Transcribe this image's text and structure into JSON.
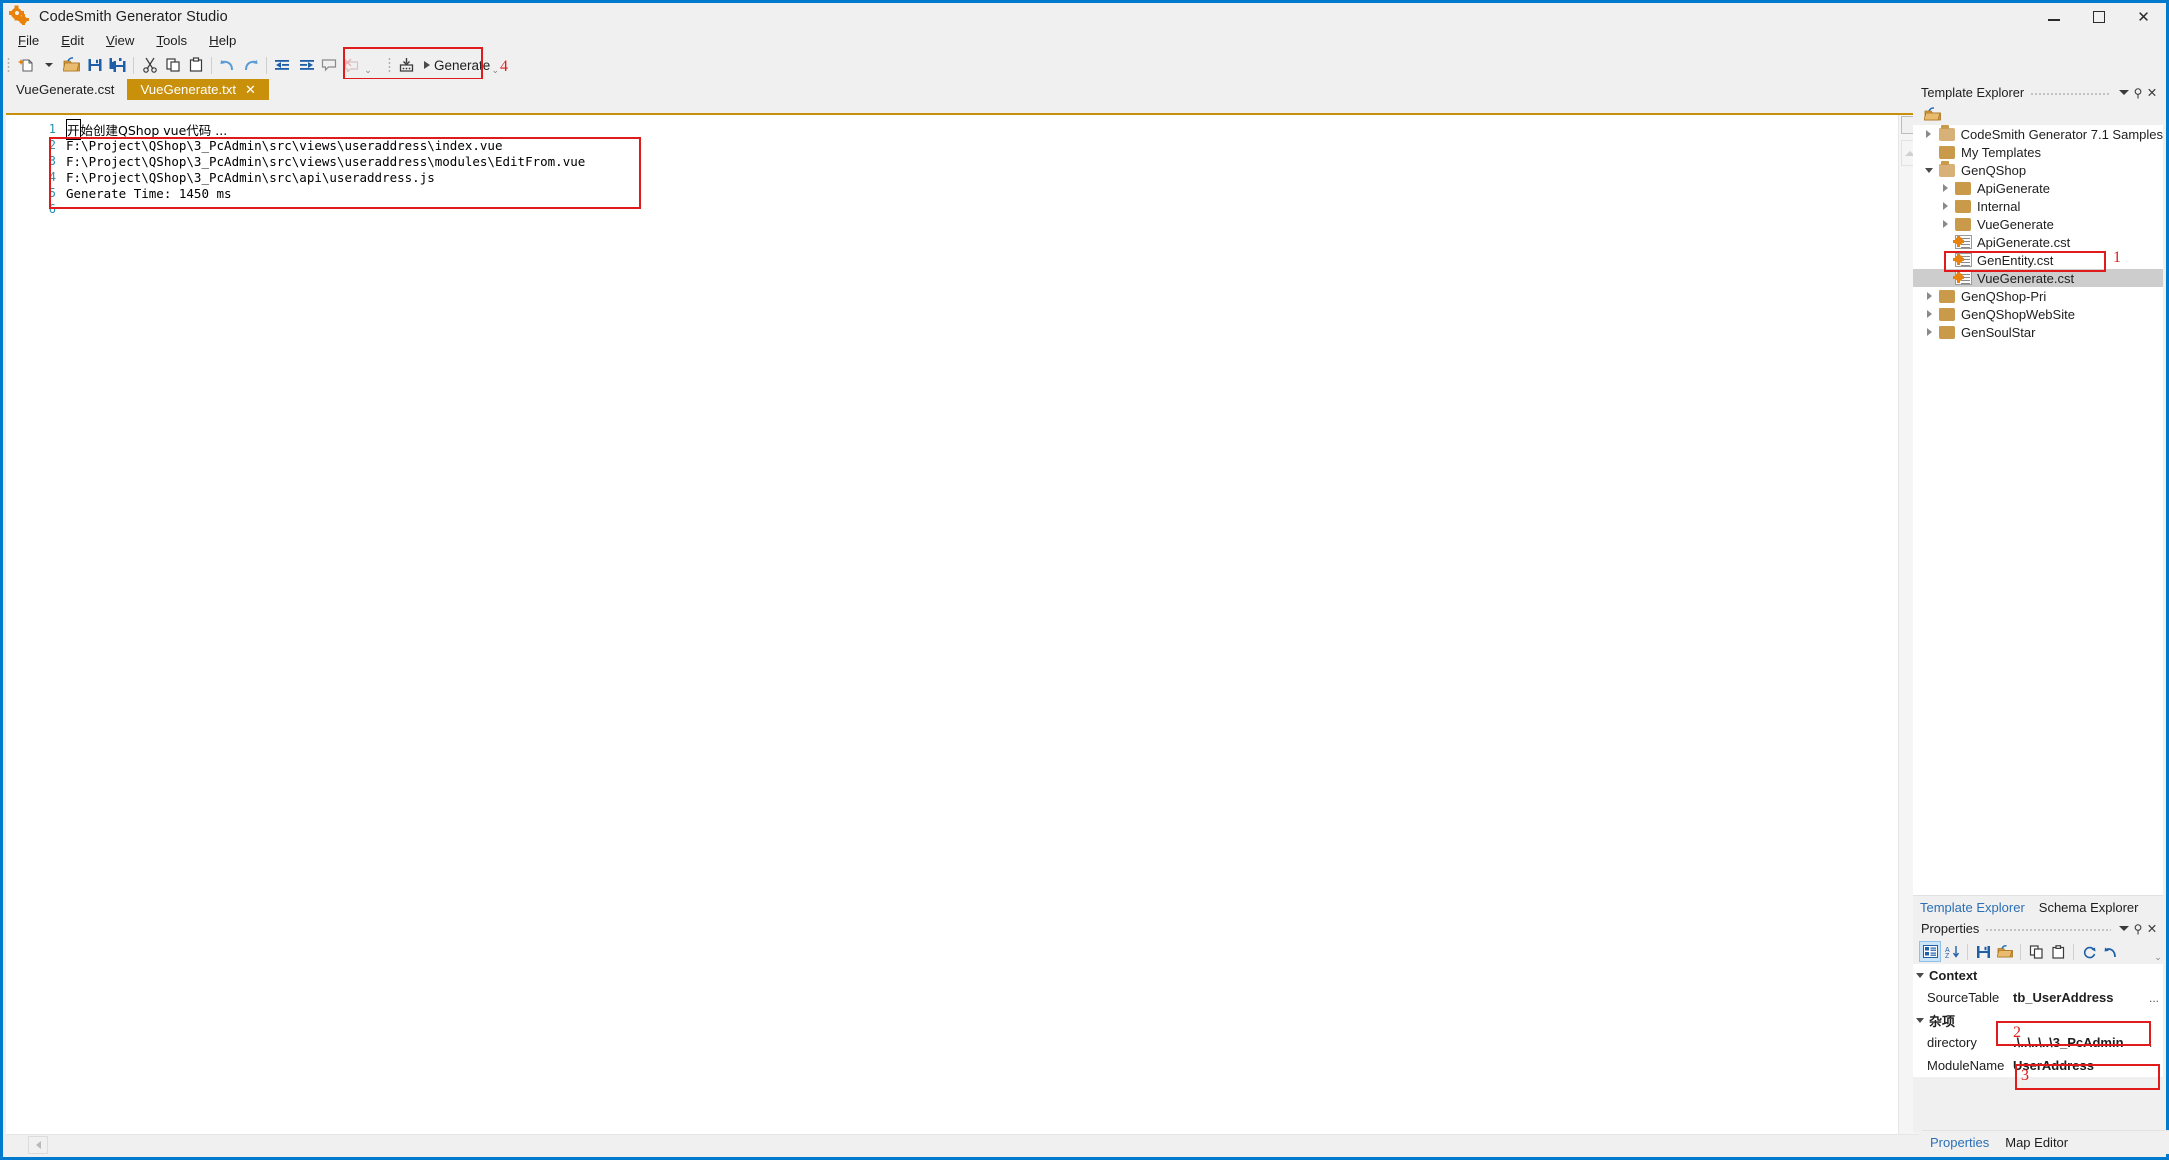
{
  "window": {
    "title": "CodeSmith Generator Studio",
    "icon": "gears-icon",
    "controls": {
      "minimize": "–",
      "maximize": "☐",
      "close": "✕"
    }
  },
  "menubar": {
    "items": [
      {
        "label": "File",
        "accel": "F"
      },
      {
        "label": "Edit",
        "accel": "E"
      },
      {
        "label": "View",
        "accel": "V"
      },
      {
        "label": "Tools",
        "accel": "T"
      },
      {
        "label": "Help",
        "accel": "H"
      }
    ]
  },
  "toolbar": {
    "icons": [
      "new-file-icon",
      "dropdown-arrow-icon",
      "open-folder-icon",
      "save-icon",
      "save-all-icon",
      "cut-icon",
      "copy-icon",
      "paste-icon",
      "undo-icon",
      "redo-icon",
      "outdent-icon",
      "indent-icon",
      "comment-icon",
      "uncomment-icon"
    ],
    "generate": {
      "label": "Generate",
      "icon": "generate-icon",
      "callout": "4",
      "highlight_color": "#e01b1b"
    }
  },
  "tabs": [
    {
      "label": "VueGenerate.cst",
      "active": false,
      "closable": false
    },
    {
      "label": "VueGenerate.txt",
      "active": true,
      "closable": true,
      "close_glyph": "✕"
    }
  ],
  "editor": {
    "lines": [
      {
        "number": "1",
        "text": "开始创建QShop vue代码 ..."
      },
      {
        "number": "2",
        "text": "F:\\Project\\QShop\\3_PcAdmin\\src\\views\\useraddress\\index.vue"
      },
      {
        "number": "3",
        "text": "F:\\Project\\QShop\\3_PcAdmin\\src\\views\\useraddress\\modules\\EditFrom.vue"
      },
      {
        "number": "4",
        "text": "F:\\Project\\QShop\\3_PcAdmin\\src\\api\\useraddress.js"
      },
      {
        "number": "5",
        "text": "Generate Time: 1450 ms"
      },
      {
        "number": "6",
        "text": ""
      }
    ],
    "highlight_color": "#e01b1b"
  },
  "template_explorer": {
    "title": "Template Explorer",
    "toolbar_icon": "open-folder-icon",
    "tree": [
      {
        "label": "CodeSmith Generator 7.1 Samples",
        "indent": 0,
        "expander": "collapsed",
        "icon": "folder-open-icon",
        "selected": false
      },
      {
        "label": "My Templates",
        "indent": 0,
        "expander": "none",
        "icon": "folder-icon",
        "selected": false
      },
      {
        "label": "GenQShop",
        "indent": 0,
        "expander": "expanded",
        "icon": "folder-open-icon",
        "selected": false
      },
      {
        "label": "ApiGenerate",
        "indent": 1,
        "expander": "collapsed",
        "icon": "folder-icon",
        "selected": false
      },
      {
        "label": "Internal",
        "indent": 1,
        "expander": "collapsed",
        "icon": "folder-icon",
        "selected": false
      },
      {
        "label": "VueGenerate",
        "indent": 1,
        "expander": "collapsed",
        "icon": "folder-icon",
        "selected": false
      },
      {
        "label": "ApiGenerate.cst",
        "indent": 1,
        "expander": "none",
        "icon": "cst-file-icon",
        "selected": false
      },
      {
        "label": "GenEntity.cst",
        "indent": 1,
        "expander": "none",
        "icon": "cst-file-icon",
        "selected": false
      },
      {
        "label": "VueGenerate.cst",
        "indent": 1,
        "expander": "none",
        "icon": "cst-file-icon",
        "selected": true
      },
      {
        "label": "GenQShop-Pri",
        "indent": 0,
        "expander": "collapsed",
        "icon": "folder-icon",
        "selected": false
      },
      {
        "label": "GenQShopWebSite",
        "indent": 0,
        "expander": "collapsed",
        "icon": "folder-icon",
        "selected": false
      },
      {
        "label": "GenSoulStar",
        "indent": 0,
        "expander": "collapsed",
        "icon": "folder-icon",
        "selected": false
      }
    ],
    "callout": "1"
  },
  "explorer_tabs": [
    {
      "label": "Template Explorer",
      "active": true
    },
    {
      "label": "Schema Explorer",
      "active": false
    }
  ],
  "properties": {
    "title": "Properties",
    "toolbar_icons": [
      "categorized-icon",
      "alphabetical-icon",
      "save-icon",
      "open-folder-icon",
      "copy-icon",
      "paste-icon",
      "refresh-icon",
      "reset-icon"
    ],
    "categories": [
      {
        "name": "Context",
        "expanded": true,
        "rows": [
          {
            "name": "SourceTable",
            "value": "tb_UserAddress",
            "ellipsis": "...",
            "callout": "2"
          }
        ]
      },
      {
        "name": "杂项",
        "expanded": true,
        "rows": [
          {
            "name": "directory",
            "value": ".\\..\\..\\..\\3_PcAdmin",
            "ellipsis": ".",
            "callout": "3"
          },
          {
            "name": "ModuleName",
            "value": "UserAddress",
            "ellipsis": "",
            "callout": ""
          }
        ]
      }
    ]
  },
  "bottom_tabs": [
    {
      "label": "Properties",
      "active": true
    },
    {
      "label": "Map Editor",
      "active": false
    }
  ]
}
